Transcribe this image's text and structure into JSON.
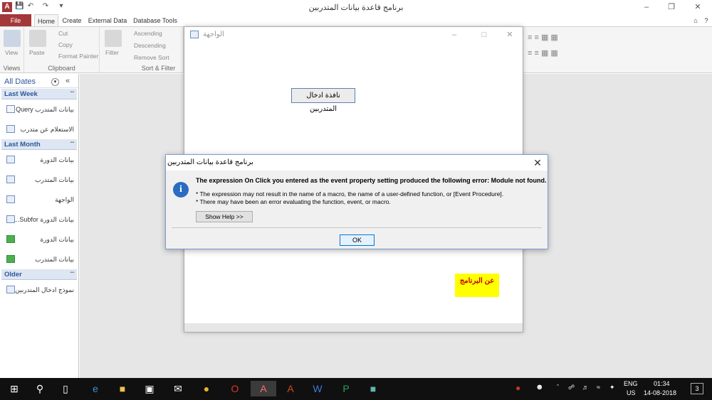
{
  "app": {
    "title": "برنامج قاعدة بيانات المتدربين",
    "icon_letter": "A"
  },
  "ribbon": {
    "tabs": [
      "File",
      "Home",
      "Create",
      "External Data",
      "Database Tools"
    ],
    "views": {
      "view_label": "View",
      "group": "Views"
    },
    "clipboard": {
      "paste": "Paste",
      "cut": "Cut",
      "copy": "Copy",
      "format_painter": "Format Painter",
      "group": "Clipboard"
    },
    "sort_filter": {
      "filter": "Filter",
      "ascending": "Ascending",
      "descending": "Descending",
      "remove_sort": "Remove Sort",
      "group": "Sort & Filter"
    }
  },
  "nav": {
    "header": "All Dates",
    "sections": [
      {
        "title": "Last Week",
        "items": [
          {
            "label": "بيانات المتدرب Query",
            "icon": "query-icon"
          },
          {
            "label": "الاستعلام عن متدرب",
            "icon": "form-icon"
          }
        ]
      },
      {
        "title": "Last Month",
        "items": [
          {
            "label": "بيانات الدورة",
            "icon": "table-icon"
          },
          {
            "label": "بيانات المتدرب",
            "icon": "table-icon"
          },
          {
            "label": "الواجهة",
            "icon": "form-icon"
          },
          {
            "label": "بيانات الدورة Subfor...",
            "icon": "form-icon"
          },
          {
            "label": "بيانات الدورة",
            "icon": "report-icon"
          },
          {
            "label": "بيانات المتدرب",
            "icon": "report-icon"
          }
        ]
      },
      {
        "title": "Older",
        "items": [
          {
            "label": "نموذج ادخال المتدربين",
            "icon": "form-icon"
          }
        ]
      }
    ]
  },
  "form": {
    "title": "الواجهة",
    "entry_button": "نافذة ادخال المتدربين",
    "about_button": "عن البرنامج"
  },
  "dialog": {
    "title": "برنامج قاعدة بيانات المتدربين",
    "main_message": "The expression On Click you entered as the event property setting produced the following error: Module not found.",
    "detail_1": "* The expression may not result in the name of a macro, the name of a user-defined function, or [Event Procedure].",
    "detail_2": "* There may have been an error evaluating the function, event, or macro.",
    "help_button": "Show Help >>",
    "ok_button": "OK"
  },
  "taskbar": {
    "lang": "ENG",
    "region": "US",
    "time": "01:34",
    "date": "14-08-2018",
    "notifications": "3"
  }
}
